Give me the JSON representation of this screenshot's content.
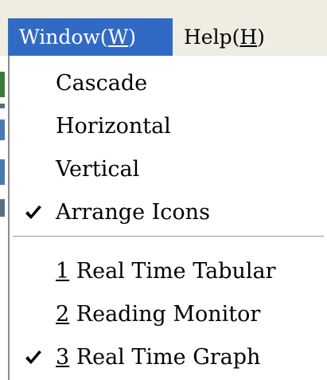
{
  "menubar": {
    "items": [
      {
        "text": "Window(",
        "accel": "W",
        "tail": ")",
        "active": true
      },
      {
        "text": "Help(",
        "accel": "H",
        "tail": ")",
        "active": false
      }
    ]
  },
  "menu": {
    "arrange_items": [
      {
        "label": "Cascade",
        "checked": false
      },
      {
        "label": "Horizontal",
        "checked": false
      },
      {
        "label": "Vertical",
        "checked": false
      },
      {
        "label": "Arrange Icons",
        "checked": true
      }
    ],
    "window_items": [
      {
        "number": "1",
        "label": " Real Time Tabular",
        "checked": false
      },
      {
        "number": "2",
        "label": " Reading Monitor",
        "checked": false
      },
      {
        "number": "3",
        "label": " Real Time Graph",
        "checked": true
      }
    ]
  },
  "colors": {
    "menubar_bg": "#efede2",
    "active_bg": "#316ac5",
    "active_text": "#ffffff"
  },
  "icons": {
    "check": "check-icon"
  }
}
